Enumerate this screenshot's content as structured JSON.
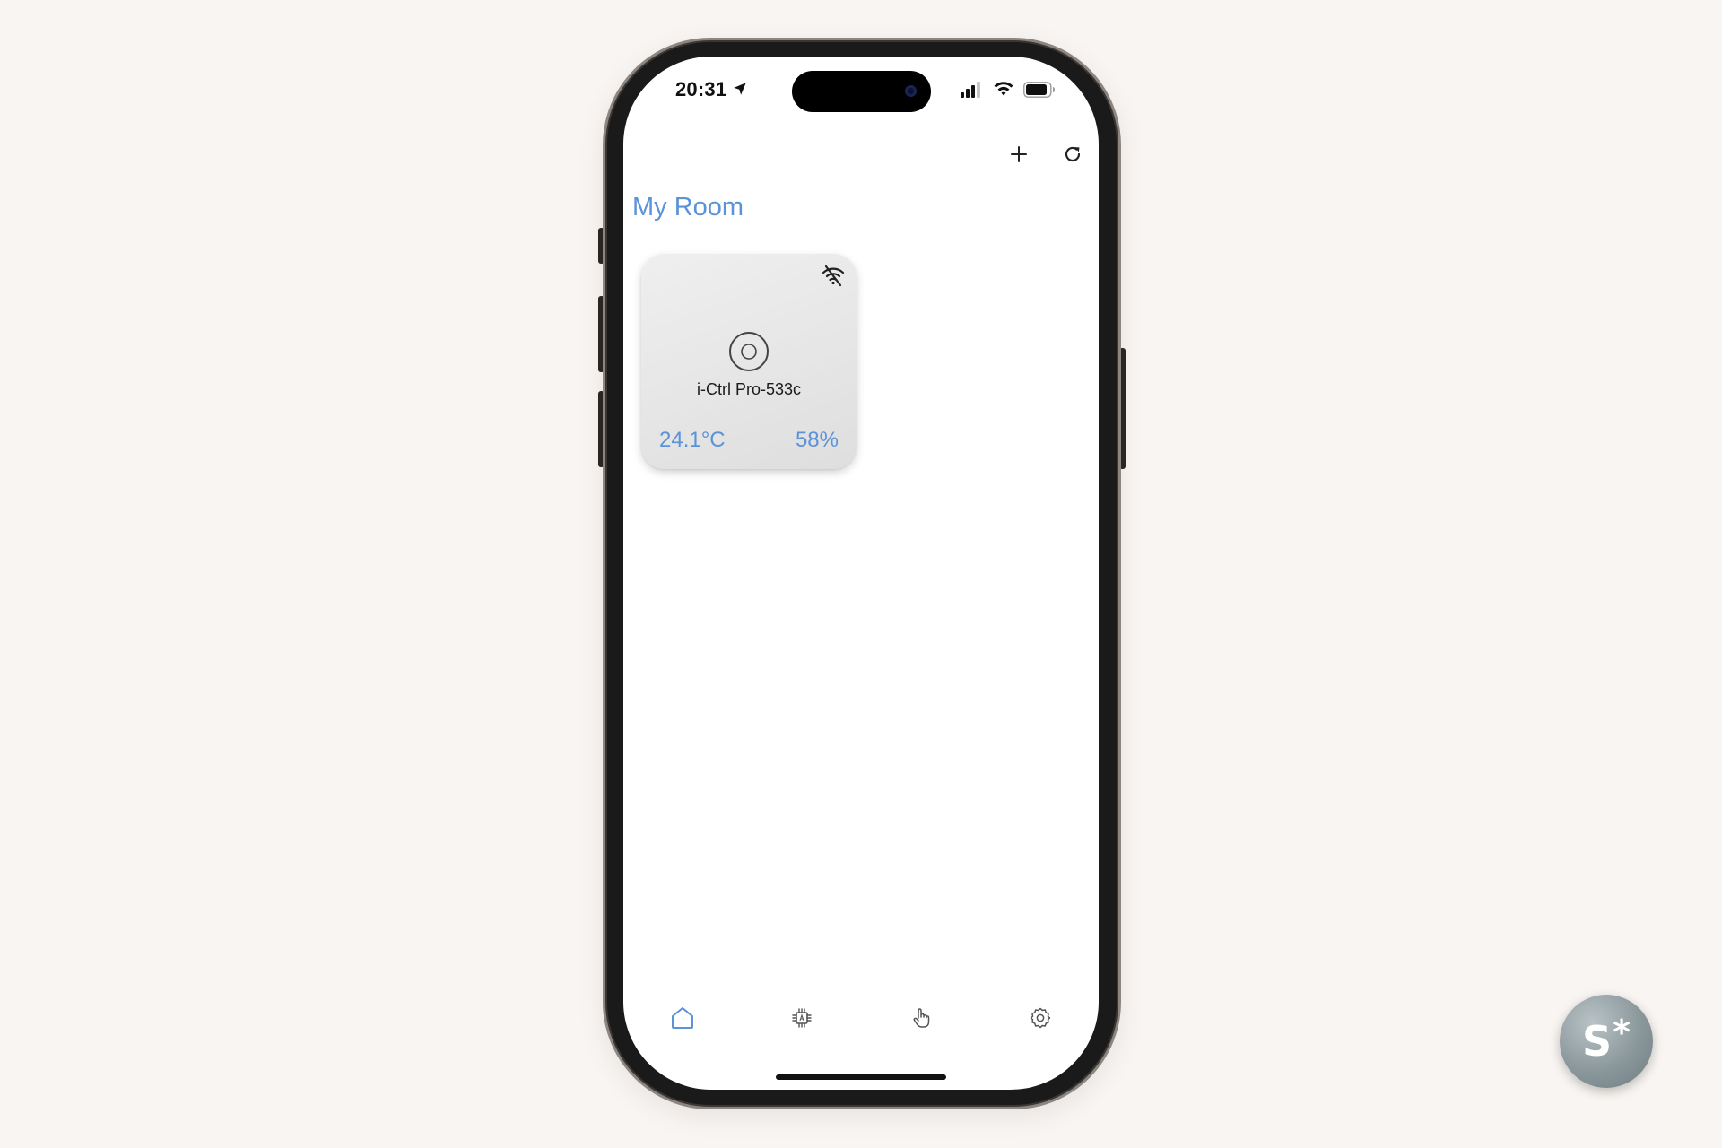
{
  "status_bar": {
    "time": "20:31"
  },
  "header": {
    "room_title": "My Room",
    "add_icon": "plus-icon",
    "refresh_icon": "refresh-icon"
  },
  "device_card": {
    "name": "i-Ctrl Pro-533c",
    "temperature": "24.1°C",
    "humidity": "58%",
    "status_icon": "wifi-off-icon",
    "device_icon": "disc-icon"
  },
  "bottom_nav": {
    "items": [
      {
        "icon": "home-icon",
        "active": true
      },
      {
        "icon": "chip-icon",
        "active": false
      },
      {
        "icon": "hand-pointer-icon",
        "active": false
      },
      {
        "icon": "gear-icon",
        "active": false
      }
    ]
  },
  "corner_badge": {
    "letter": "S",
    "mark": "*"
  },
  "colors": {
    "accent": "#5b93d8",
    "background": "#f9f5f2",
    "card": "#e6e6e6"
  }
}
